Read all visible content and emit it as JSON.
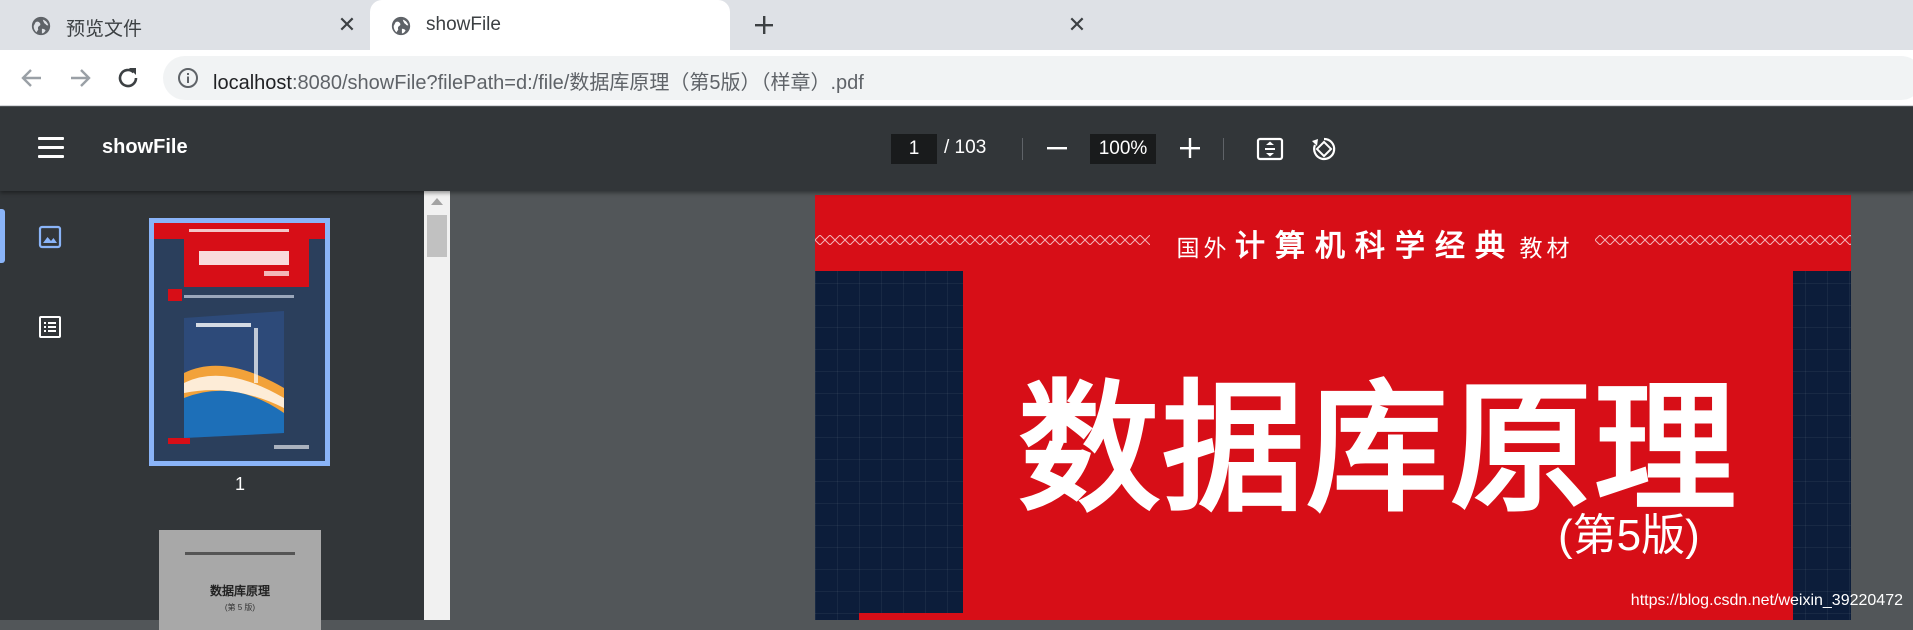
{
  "browser": {
    "tabs": [
      {
        "title": "预览文件",
        "active": false,
        "icon": "globe-icon"
      },
      {
        "title": "showFile",
        "active": true,
        "icon": "globe-icon"
      }
    ],
    "new_tab_icon": "plus-icon",
    "url_host": "localhost",
    "url_rest": ":8080/showFile?filePath=d:/file/数据库原理（第5版）（样章）.pdf"
  },
  "pdf_toolbar": {
    "title": "showFile",
    "current_page": "1",
    "page_total": "/ 103",
    "zoom": "100%"
  },
  "sidebar": {
    "views": [
      "thumbnails-icon",
      "outline-icon"
    ],
    "thumbnails": [
      {
        "label": "1",
        "selected": true
      },
      {
        "title": "数据库原理",
        "edition": "(第 5 版)"
      }
    ]
  },
  "page_content": {
    "series_prefix": "国外",
    "series_main": "计算机科学经典",
    "series_suffix": "教材",
    "book_title": "数据库原理",
    "edition": "(第5版)"
  },
  "watermark": "https://blog.csdn.net/weixin_39220472",
  "colors": {
    "accent": "#8ab4f8",
    "cover_red": "#d70e17",
    "cover_navy": "#0c1d3a",
    "viewer_toolbar": "#323639",
    "viewer_bg": "#525659"
  }
}
